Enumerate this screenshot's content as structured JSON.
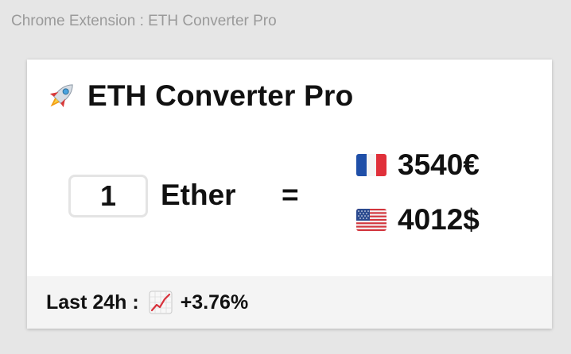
{
  "window": {
    "caption": "Chrome Extension : ETH Converter Pro"
  },
  "header": {
    "icon": "rocket-icon",
    "title": "ETH Converter Pro"
  },
  "converter": {
    "amount": "1",
    "unit": "Ether",
    "equals": "=",
    "rates": [
      {
        "flag": "france-flag-icon",
        "value": "3540€"
      },
      {
        "flag": "usa-flag-icon",
        "value": "4012$"
      }
    ]
  },
  "footer": {
    "label": "Last 24h :",
    "icon": "chart-increasing-icon",
    "change": "+3.76%"
  }
}
